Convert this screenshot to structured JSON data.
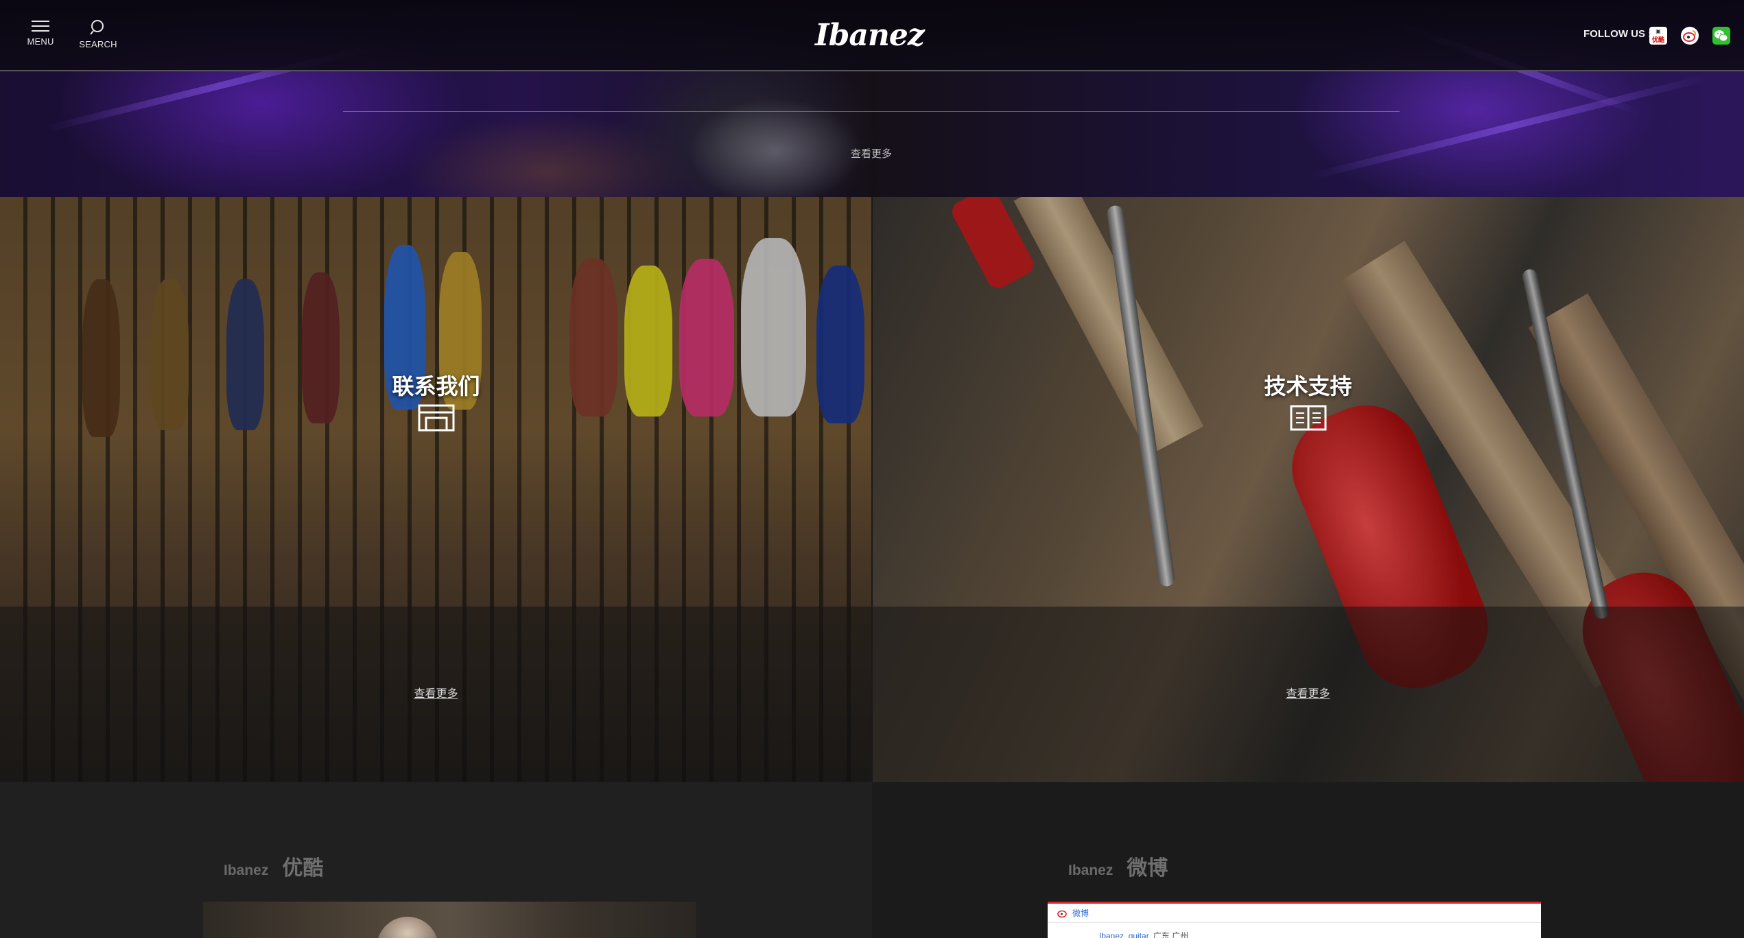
{
  "header": {
    "menu_label": "MENU",
    "search_label": "SEARCH",
    "logo_text": "Ibanez",
    "follow_label": "FOLLOW US :",
    "social": [
      {
        "name": "youku-icon",
        "text": "优酷"
      },
      {
        "name": "weibo-icon"
      },
      {
        "name": "wechat-icon"
      }
    ]
  },
  "top_banner": {
    "more_label": "查看更多"
  },
  "panels": [
    {
      "title": "联系我们",
      "icon": "storefront-icon",
      "more_label": "查看更多"
    },
    {
      "title": "技术支持",
      "icon": "open-book-icon",
      "more_label": "查看更多"
    }
  ],
  "youku_section": {
    "brand": "Ibanez",
    "name": "优酷"
  },
  "weibo_section": {
    "brand": "Ibanez",
    "name": "微博"
  },
  "weibo_widget": {
    "bar_label": "微博",
    "account": "Ibanez_guitar",
    "location": "广东 广州"
  },
  "colors": {
    "header_bg": "#0e0a16",
    "weibo_red": "#e0242e",
    "wechat_green": "#2fc12f"
  }
}
